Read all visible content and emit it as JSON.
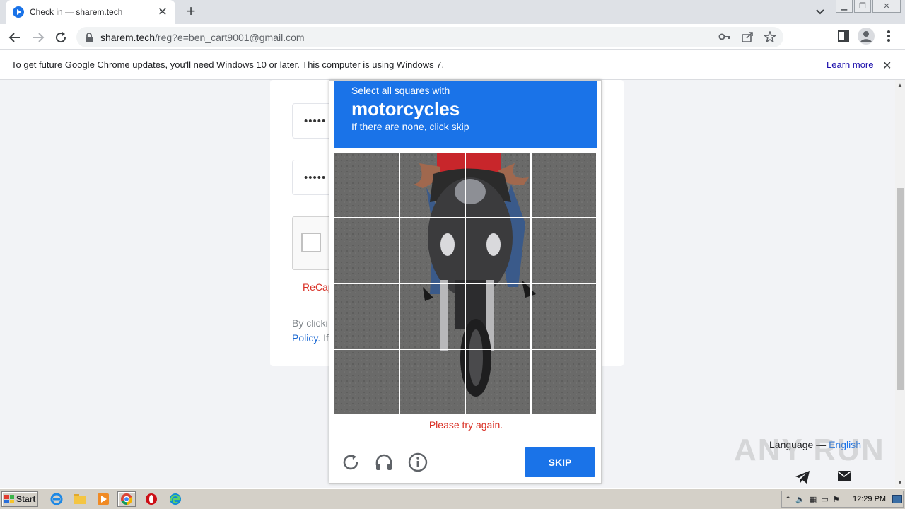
{
  "browser": {
    "tab_title": "Check in — sharem.tech",
    "new_tab_label": "+",
    "url_host": "sharem.tech",
    "url_path": "/reg?e=ben_cart9001@gmail.com"
  },
  "infobar": {
    "message": "To get future Google Chrome updates, you'll need Windows 10 or later. This computer is using Windows 7.",
    "learn_more": "Learn more"
  },
  "form": {
    "password_mask": "•••••",
    "confirm_mask": "•••••",
    "recaptcha_error": "ReCap",
    "terms_line1": "By clicki",
    "terms_policy": "Policy.",
    "terms_line2_rest": " If"
  },
  "challenge": {
    "line1": "Select all squares with",
    "object": "motorcycles",
    "line3": "If there are none, click skip",
    "error": "Please try again.",
    "skip_label": "SKIP",
    "header_color": "#1a73e8",
    "tiles_selected": 0,
    "tile_count": 16
  },
  "footer": {
    "language_label": "Language — ",
    "language_value": "English"
  },
  "watermark": "ANY RUN",
  "taskbar": {
    "start_label": "Start",
    "clock": "12:29 PM"
  }
}
